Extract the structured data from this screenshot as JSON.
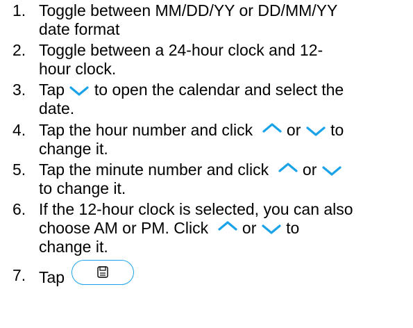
{
  "colors": {
    "icon_blue": "#1aa3e8",
    "text": "#000000"
  },
  "icons": {
    "chevron_down": "chevron-down-icon",
    "chevron_up": "chevron-up-icon",
    "save": "save-icon"
  },
  "steps": [
    {
      "num": "1.",
      "line1": "Toggle between MM/DD/YY or DD/MM/YY",
      "line2": "date format"
    },
    {
      "num": "2.",
      "line1": "Toggle between a 24-hour clock and 12-",
      "line2": "hour clock."
    },
    {
      "num": "3.",
      "pre": "Tap ",
      "post": " to open the calendar and select the",
      "line2": "date."
    },
    {
      "num": "4.",
      "pre": "Tap the hour number and click ",
      "mid": " or ",
      "post": " to",
      "line2": "change it."
    },
    {
      "num": "5.",
      "pre": "Tap the minute number and click ",
      "mid": " or ",
      "line2": "to change it."
    },
    {
      "num": "6.",
      "line1": "If the 12-hour clock is selected, you can also",
      "pre2": "choose AM or PM. Click ",
      "mid": " or ",
      "post2": " to",
      "line3": "change it."
    },
    {
      "num": "7.",
      "pre": "Tap "
    }
  ]
}
